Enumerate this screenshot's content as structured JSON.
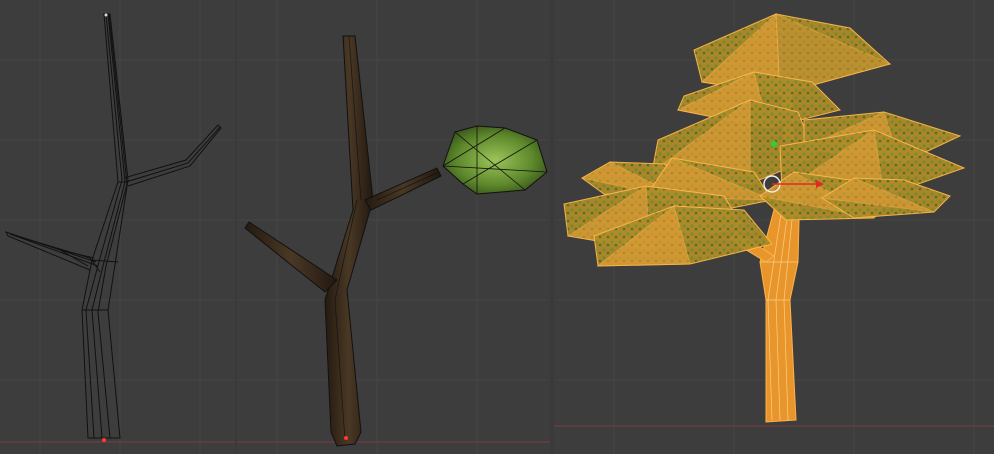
{
  "colors": {
    "viewport_background": "#3d3d3d",
    "grid_line": "#454545",
    "grid_axis_x": "#7a3c3c",
    "wireframe": "#111111",
    "bark": "#3b2c1c",
    "leaf_green": "#5f8a2c",
    "selection_orange": "#ffa23a",
    "selection_fill": "#e89a2e",
    "origin_red": "#ff3b2f",
    "gizmo_green": "#2bd13a",
    "gizmo_red": "#e02a22",
    "cursor_white": "#f0f0f0"
  },
  "panels": [
    {
      "mode": "wireframe",
      "object": "tree-trunk-wireframe"
    },
    {
      "mode": "textured",
      "object": "tree-trunk-with-leaf-cluster"
    },
    {
      "mode": "selected-wireframe-overlay",
      "object": "full-tree-selected"
    }
  ]
}
